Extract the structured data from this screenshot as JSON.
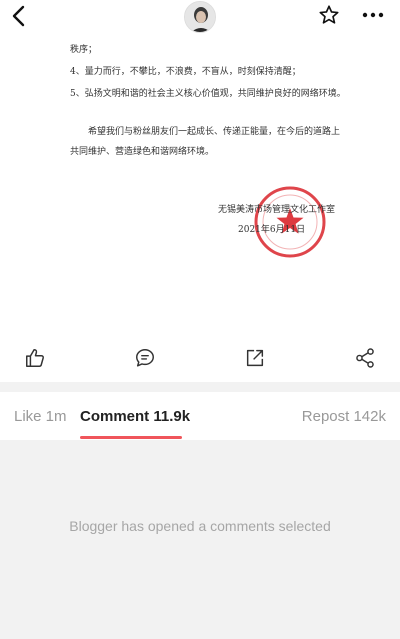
{
  "document": {
    "lines": [
      "秩序；",
      "4、量力而行，不攀比，不浪费，不盲从，时刻保持清醒；",
      "5、弘扬文明和谐的社会主义核心价值观，共同维护良好的网络环境。",
      "希望我们与粉丝朋友们一起成长、传递正能量，在今后的道路上",
      "共同维护、营造绿色和谐网络环境。",
      "无锡美涛市场管理文化工作室",
      "2021年6月11日"
    ],
    "seal_color": "#d9252b"
  },
  "actions": {
    "icons": [
      "thumbs-up-icon",
      "comment-bubble-icon",
      "share-arrow-icon",
      "share-nodes-icon"
    ]
  },
  "tabs": {
    "like_label": "Like 1m",
    "comment_label": "Comment 11.9k",
    "repost_label": "Repost 142k",
    "active": "comment",
    "accent_color": "#f0555b"
  },
  "comments": {
    "message": "Blogger has opened a comments selected"
  }
}
